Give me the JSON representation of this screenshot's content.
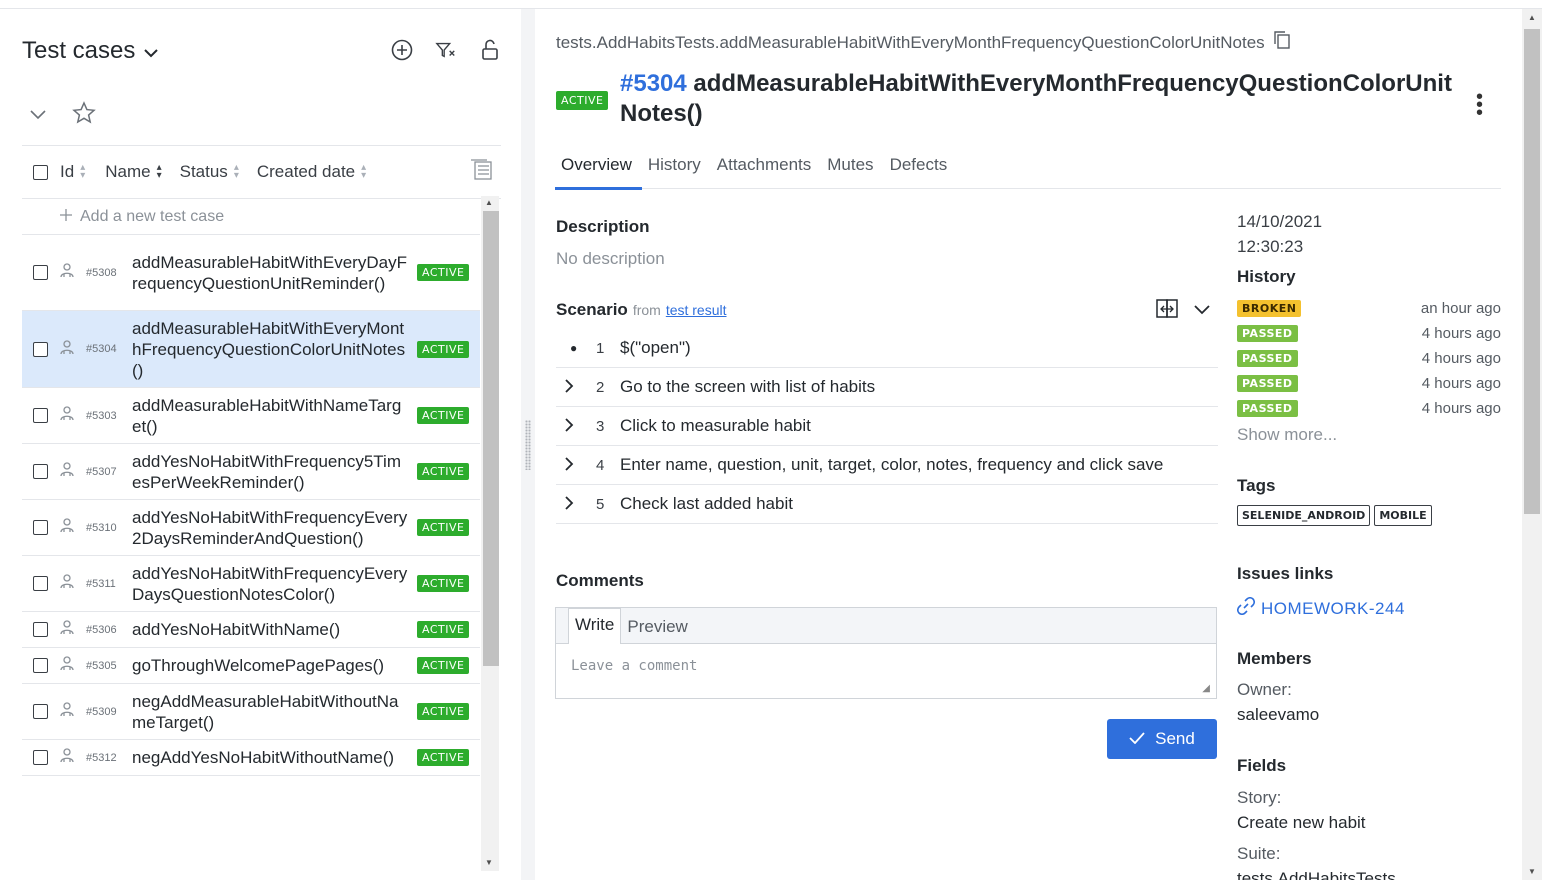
{
  "left": {
    "title": "Test cases",
    "header": {
      "id": "Id",
      "name": "Name",
      "status": "Status",
      "created": "Created date"
    },
    "add_new": "Add a new test case",
    "rows": [
      {
        "id": "#5308",
        "name": "addMeasurableHabitWithEveryDayFrequencyQuestionUnitReminder()",
        "status": "ACTIVE",
        "selected": false
      },
      {
        "id": "#5304",
        "name": "addMeasurableHabitWithEveryMonthFrequencyQuestionColorUnitNotes()",
        "status": "ACTIVE",
        "selected": true
      },
      {
        "id": "#5303",
        "name": "addMeasurableHabitWithNameTarget()",
        "status": "ACTIVE",
        "selected": false
      },
      {
        "id": "#5307",
        "name": "addYesNoHabitWithFrequency5TimesPerWeekReminder()",
        "status": "ACTIVE",
        "selected": false
      },
      {
        "id": "#5310",
        "name": "addYesNoHabitWithFrequencyEvery2DaysReminderAndQuestion()",
        "status": "ACTIVE",
        "selected": false
      },
      {
        "id": "#5311",
        "name": "addYesNoHabitWithFrequencyEveryDaysQuestionNotesColor()",
        "status": "ACTIVE",
        "selected": false
      },
      {
        "id": "#5306",
        "name": "addYesNoHabitWithName()",
        "status": "ACTIVE",
        "selected": false
      },
      {
        "id": "#5305",
        "name": "goThroughWelcomePagePages()",
        "status": "ACTIVE",
        "selected": false
      },
      {
        "id": "#5309",
        "name": "negAddMeasurableHabitWithoutNameTarget()",
        "status": "ACTIVE",
        "selected": false
      },
      {
        "id": "#5312",
        "name": "negAddYesNoHabitWithoutName()",
        "status": "ACTIVE",
        "selected": false
      }
    ]
  },
  "detail": {
    "path": "tests.AddHabitsTests.addMeasurableHabitWithEveryMonthFrequencyQuestionColorUnitNotes",
    "status": "ACTIVE",
    "number": "#5304",
    "title_line1": "addMeasurableHabitWithEveryMonthFrequencyQuestionColorUnit",
    "title_line2": "Notes()",
    "tabs": [
      "Overview",
      "History",
      "Attachments",
      "Mutes",
      "Defects"
    ],
    "description_label": "Description",
    "description_value": "No description",
    "scenario_label": "Scenario",
    "scenario_from": "from",
    "scenario_link": "test result",
    "steps": [
      {
        "n": "1",
        "text": "$(\"open\")"
      },
      {
        "n": "2",
        "text": "Go to the screen with list of habits"
      },
      {
        "n": "3",
        "text": "Click to measurable habit"
      },
      {
        "n": "4",
        "text": "Enter name, question, unit, target, color, notes, frequency and click save"
      },
      {
        "n": "5",
        "text": "Check last added habit"
      }
    ],
    "comments_label": "Comments",
    "comment_tabs": {
      "write": "Write",
      "preview": "Preview"
    },
    "comment_placeholder": "Leave a comment",
    "send_label": "Send"
  },
  "sidebar": {
    "date": "14/10/2021",
    "time": "12:30:23",
    "history_label": "History",
    "history": [
      {
        "status": "BROKEN",
        "ago": "an hour ago"
      },
      {
        "status": "PASSED",
        "ago": "4 hours ago"
      },
      {
        "status": "PASSED",
        "ago": "4 hours ago"
      },
      {
        "status": "PASSED",
        "ago": "4 hours ago"
      },
      {
        "status": "PASSED",
        "ago": "4 hours ago"
      }
    ],
    "show_more": "Show more...",
    "tags_label": "Tags",
    "tags": [
      "SELENIDE_ANDROID",
      "MOBILE"
    ],
    "issues_label": "Issues links",
    "issue": "HOMEWORK-244",
    "members_label": "Members",
    "owner_label": "Owner:",
    "owner": "saleevamo",
    "fields_label": "Fields",
    "story_label": "Story:",
    "story": "Create new habit",
    "suite_label": "Suite:",
    "suite": "tests.AddHabitsTests"
  },
  "colors": {
    "accent": "#2f6fdc",
    "active": "#2dac2d",
    "broken": "#f4c12e",
    "passed": "#7bbf44",
    "selected_row": "#dbe9fb"
  }
}
